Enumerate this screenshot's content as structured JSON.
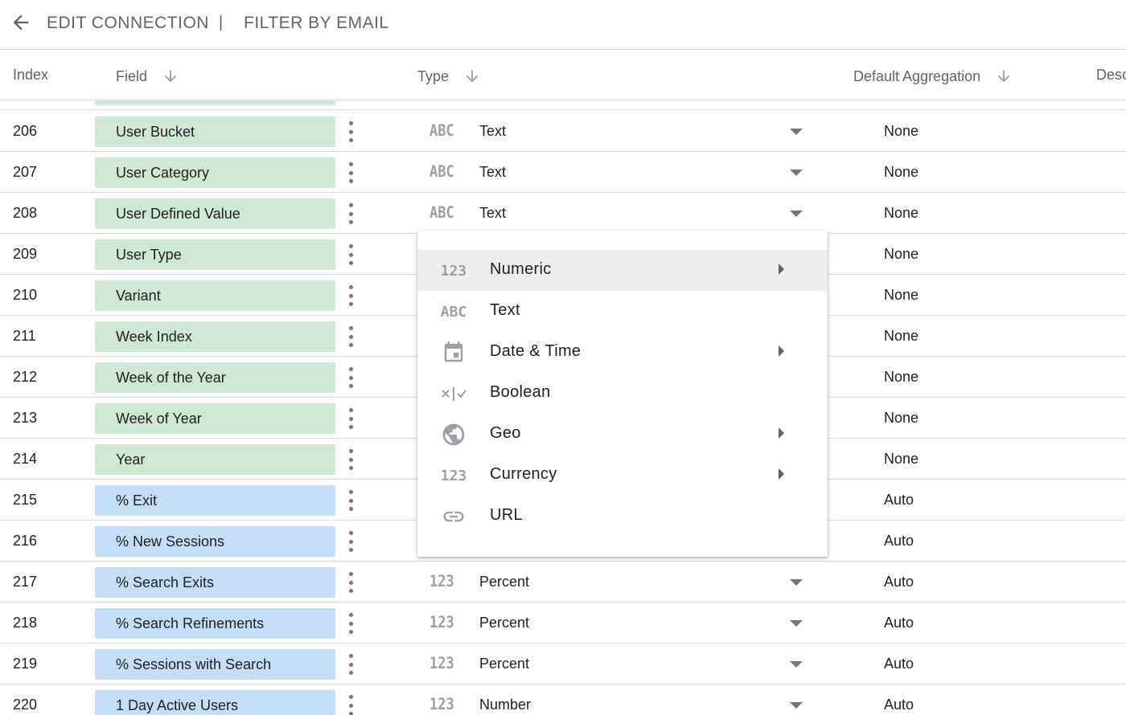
{
  "header": {
    "back_icon": "arrow-back-icon",
    "crumb1": "EDIT CONNECTION",
    "separator": "|",
    "crumb2": "FILTER BY EMAIL"
  },
  "columns": {
    "index": "Index",
    "field": "Field",
    "type": "Type",
    "aggregation": "Default Aggregation",
    "description": "Description"
  },
  "rows": [
    {
      "index": "206",
      "field": "User Bucket",
      "kind": "dimension",
      "type_icon": "ABC",
      "type": "Text",
      "aggregation": "None"
    },
    {
      "index": "207",
      "field": "User Category",
      "kind": "dimension",
      "type_icon": "ABC",
      "type": "Text",
      "aggregation": "None"
    },
    {
      "index": "208",
      "field": "User Defined Value",
      "kind": "dimension",
      "type_icon": "ABC",
      "type": "Text",
      "aggregation": "None"
    },
    {
      "index": "209",
      "field": "User Type",
      "kind": "dimension",
      "type_icon": "",
      "type": "",
      "aggregation": "None"
    },
    {
      "index": "210",
      "field": "Variant",
      "kind": "dimension",
      "type_icon": "",
      "type": "",
      "aggregation": "None"
    },
    {
      "index": "211",
      "field": "Week Index",
      "kind": "dimension",
      "type_icon": "",
      "type": "",
      "aggregation": "None"
    },
    {
      "index": "212",
      "field": "Week of the Year",
      "kind": "dimension",
      "type_icon": "",
      "type": "",
      "aggregation": "None"
    },
    {
      "index": "213",
      "field": "Week of Year",
      "kind": "dimension",
      "type_icon": "",
      "type": "",
      "aggregation": "None"
    },
    {
      "index": "214",
      "field": "Year",
      "kind": "dimension",
      "type_icon": "",
      "type": "",
      "aggregation": "None"
    },
    {
      "index": "215",
      "field": "% Exit",
      "kind": "metric",
      "type_icon": "",
      "type": "",
      "aggregation": "Auto"
    },
    {
      "index": "216",
      "field": "% New Sessions",
      "kind": "metric",
      "type_icon": "",
      "type": "",
      "aggregation": "Auto"
    },
    {
      "index": "217",
      "field": "% Search Exits",
      "kind": "metric",
      "type_icon": "123",
      "type": "Percent",
      "aggregation": "Auto"
    },
    {
      "index": "218",
      "field": "% Search Refinements",
      "kind": "metric",
      "type_icon": "123",
      "type": "Percent",
      "aggregation": "Auto"
    },
    {
      "index": "219",
      "field": "% Sessions with Search",
      "kind": "metric",
      "type_icon": "123",
      "type": "Percent",
      "aggregation": "Auto"
    },
    {
      "index": "220",
      "field": "1 Day Active Users",
      "kind": "metric",
      "type_icon": "123",
      "type": "Number",
      "aggregation": "Auto"
    }
  ],
  "type_menu": {
    "items": [
      {
        "label": "Numeric",
        "icon": "123",
        "icon_name": "numeric-icon",
        "submenu": true,
        "active": true
      },
      {
        "label": "Text",
        "icon": "ABC",
        "icon_name": "text-icon",
        "submenu": false,
        "active": false
      },
      {
        "label": "Date & Time",
        "icon": "",
        "icon_name": "calendar-icon",
        "submenu": true,
        "active": false
      },
      {
        "label": "Boolean",
        "icon": "",
        "icon_name": "boolean-icon",
        "submenu": false,
        "active": false
      },
      {
        "label": "Geo",
        "icon": "",
        "icon_name": "globe-icon",
        "submenu": true,
        "active": false
      },
      {
        "label": "Currency",
        "icon": "123",
        "icon_name": "currency-icon",
        "submenu": true,
        "active": false
      },
      {
        "label": "URL",
        "icon": "",
        "icon_name": "link-icon",
        "submenu": false,
        "active": false
      }
    ]
  },
  "colors": {
    "dimension_chip": "#cfe8d1",
    "metric_chip": "#c3def6",
    "menu_highlight": "#eeeeee",
    "divider": "#dadce0",
    "icon_gray": "#9aa0a6"
  }
}
